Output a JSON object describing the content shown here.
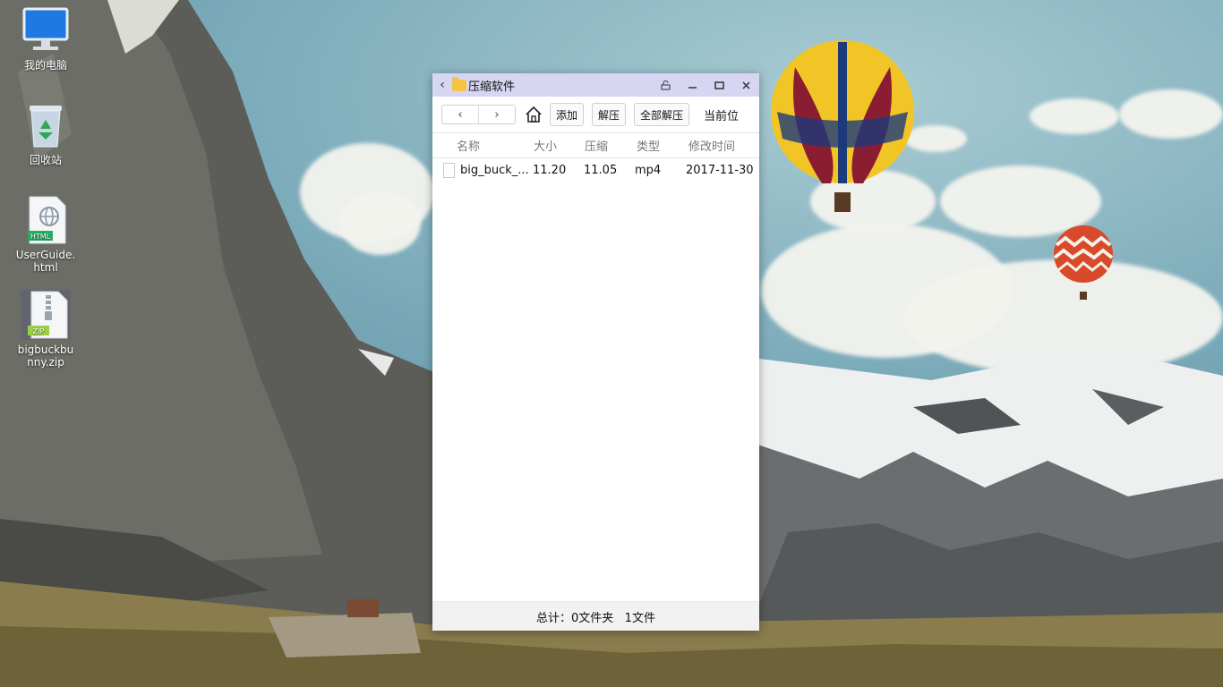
{
  "desktop": {
    "icons": [
      {
        "label": "我的电脑",
        "icon": "computer-icon"
      },
      {
        "label": "回收站",
        "icon": "recycle-bin-icon"
      },
      {
        "label": "UserGuide.html",
        "icon": "html-file-icon",
        "badge": "HTML"
      },
      {
        "label": "bigbuckbunny.zip",
        "icon": "zip-file-icon",
        "badge": "ZIP"
      }
    ]
  },
  "window": {
    "title": "压缩软件",
    "toolbar": {
      "add_label": "添加",
      "extract_label": "解压",
      "extract_all_label": "全部解压",
      "current_location_label": "当前位"
    },
    "columns": [
      "名称",
      "大小",
      "压缩",
      "类型",
      "修改时间"
    ],
    "files": [
      {
        "name": "big_buck_...",
        "size": "11.20",
        "compressed": "11.05",
        "type": "mp4",
        "modified": "2017-11-30"
      }
    ],
    "status": "总计：0文件夹   1文件"
  },
  "colors": {
    "titlebar": "#d6d6f2",
    "folder": "#f6c445",
    "statusbar": "#f2f2f2"
  }
}
